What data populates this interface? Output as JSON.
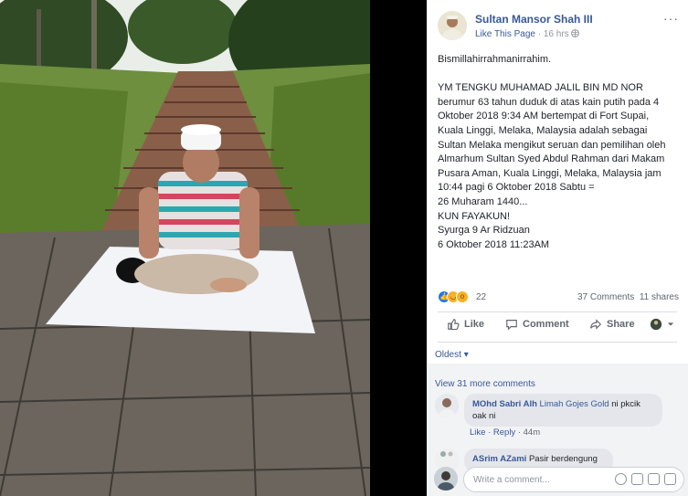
{
  "post": {
    "page_name": "Sultan Mansor Shah III",
    "like_page": "Like This Page",
    "dot": "·",
    "time": "16 hrs",
    "more": "···",
    "lines": [
      "Bismillahirrahmanirrahim.",
      "",
      "YM TENGKU MUHAMAD JALIL BIN MD NOR",
      "berumur 63 tahun duduk di atas kain putih pada 4",
      "Oktober 2018 9:34 AM bertempat di Fort Supai,",
      "Kuala Linggi, Melaka, Malaysia adalah sebagai",
      "Sultan Melaka mengikut seruan dan pemilihan oleh",
      "Almarhum Sultan Syed Abdul Rahman dari Makam",
      "Pusara Aman, Kuala Linggi, Melaka, Malaysia jam",
      "10:44 pagi 6 Oktober 2018 Sabtu =",
      "26 Muharam 1440...",
      "KUN FAYAKUN!",
      "Syurga 9 Ar Ridzuan",
      "6 Oktober 2018 11:23AM"
    ]
  },
  "reactions": {
    "icons": [
      "like-icon",
      "haha-icon",
      "wow-icon"
    ],
    "count": "22",
    "comments": "37 Comments",
    "shares": "11 shares"
  },
  "actions": {
    "like": "Like",
    "comment": "Comment",
    "share": "Share"
  },
  "sort_label": "Oldest",
  "comments": {
    "view_more": "View 31 more comments",
    "items": [
      {
        "author": "MOhd Sabri Alh",
        "tag": "Limah Gojes Gold",
        "text_line1": " ni pkcik",
        "text_line2": "oak ni",
        "like": "Like",
        "reply": "Reply",
        "sep": "·",
        "time": "44m"
      },
      {
        "author": "ASrim AZami",
        "text": " Pasir berdengung"
      }
    ],
    "write_placeholder": "Write a comment..."
  },
  "colors": {
    "link": "#385898",
    "text": "#1d2129",
    "muted": "#606770"
  }
}
